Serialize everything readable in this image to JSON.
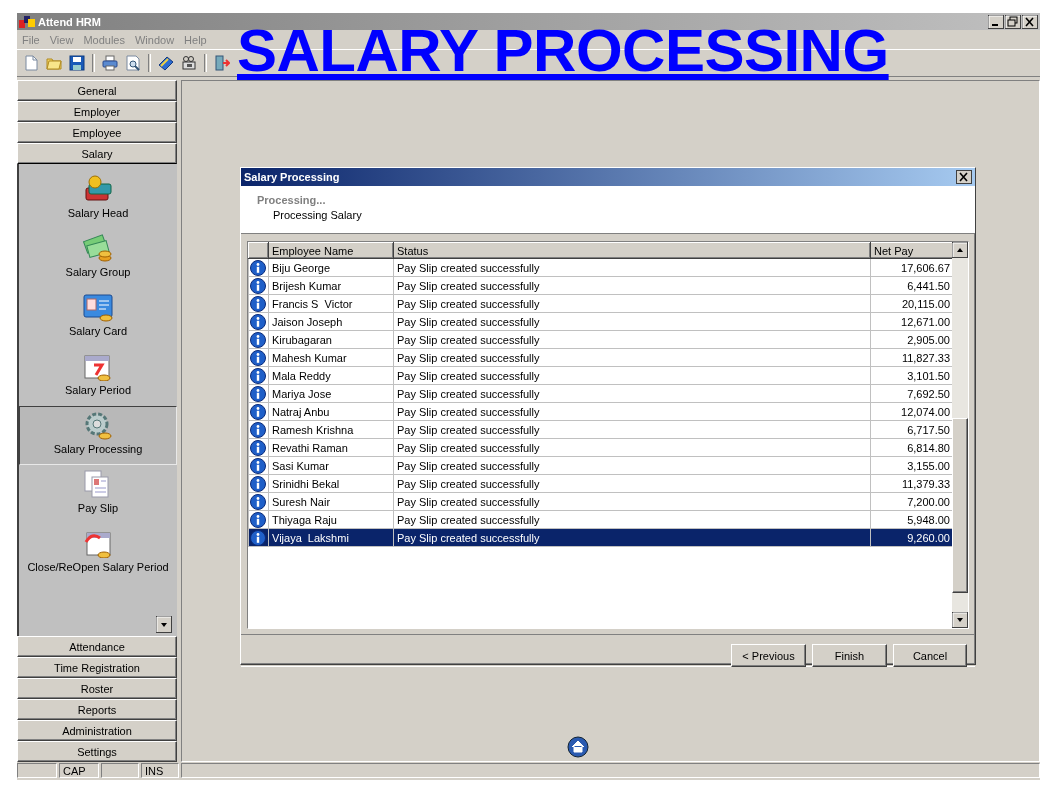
{
  "window": {
    "title": "Attend HRM"
  },
  "menu": [
    "File",
    "View",
    "Modules",
    "Window",
    "Help"
  ],
  "banner": "SALARY PROCESSING",
  "sidebar": {
    "sections": [
      {
        "label": "General",
        "expanded": false
      },
      {
        "label": "Employer",
        "expanded": false
      },
      {
        "label": "Employee",
        "expanded": false
      },
      {
        "label": "Salary",
        "expanded": true,
        "items": [
          {
            "label": "Salary Head",
            "selected": false
          },
          {
            "label": "Salary Group",
            "selected": false
          },
          {
            "label": "Salary Card",
            "selected": false
          },
          {
            "label": "Salary Period",
            "selected": false
          },
          {
            "label": "Salary Processing",
            "selected": true
          },
          {
            "label": "Pay Slip",
            "selected": false
          },
          {
            "label": "Close/ReOpen Salary Period",
            "selected": false
          }
        ]
      },
      {
        "label": "Attendance",
        "expanded": false
      },
      {
        "label": "Time Registration",
        "expanded": false
      },
      {
        "label": "Roster",
        "expanded": false
      },
      {
        "label": "Reports",
        "expanded": false
      },
      {
        "label": "Administration",
        "expanded": false
      },
      {
        "label": "Settings",
        "expanded": false
      }
    ]
  },
  "dialog": {
    "title": "Salary Processing",
    "heading": "Processing...",
    "subheading": "Processing Salary",
    "table": {
      "columns": [
        "Employee Name",
        "Status",
        "Net Pay"
      ],
      "rows": [
        {
          "employee_name": "Biju George",
          "status": "Pay Slip created successfully",
          "net_pay": "17,606.67",
          "selected": false
        },
        {
          "employee_name": "Brijesh Kumar",
          "status": "Pay Slip created successfully",
          "net_pay": "6,441.50",
          "selected": false
        },
        {
          "employee_name": "Francis S  Victor",
          "status": "Pay Slip created successfully",
          "net_pay": "20,115.00",
          "selected": false
        },
        {
          "employee_name": "Jaison Joseph",
          "status": "Pay Slip created successfully",
          "net_pay": "12,671.00",
          "selected": false
        },
        {
          "employee_name": "Kirubagaran",
          "status": "Pay Slip created successfully",
          "net_pay": "2,905.00",
          "selected": false
        },
        {
          "employee_name": "Mahesh Kumar",
          "status": "Pay Slip created successfully",
          "net_pay": "11,827.33",
          "selected": false
        },
        {
          "employee_name": "Mala Reddy",
          "status": "Pay Slip created successfully",
          "net_pay": "3,101.50",
          "selected": false
        },
        {
          "employee_name": "Mariya Jose",
          "status": "Pay Slip created successfully",
          "net_pay": "7,692.50",
          "selected": false
        },
        {
          "employee_name": "Natraj Anbu",
          "status": "Pay Slip created successfully",
          "net_pay": "12,074.00",
          "selected": false
        },
        {
          "employee_name": "Ramesh Krishna",
          "status": "Pay Slip created successfully",
          "net_pay": "6,717.50",
          "selected": false
        },
        {
          "employee_name": "Revathi Raman",
          "status": "Pay Slip created successfully",
          "net_pay": "6,814.80",
          "selected": false
        },
        {
          "employee_name": "Sasi Kumar",
          "status": "Pay Slip created successfully",
          "net_pay": "3,155.00",
          "selected": false
        },
        {
          "employee_name": "Srinidhi Bekal",
          "status": "Pay Slip created successfully",
          "net_pay": "11,379.33",
          "selected": false
        },
        {
          "employee_name": "Suresh Nair",
          "status": "Pay Slip created successfully",
          "net_pay": "7,200.00",
          "selected": false
        },
        {
          "employee_name": "Thiyaga Raju",
          "status": "Pay Slip created successfully",
          "net_pay": "5,948.00",
          "selected": false
        },
        {
          "employee_name": "Vijaya  Lakshmi",
          "status": "Pay Slip created successfully",
          "net_pay": "9,260.00",
          "selected": true
        }
      ]
    },
    "buttons": [
      "< Previous",
      "Finish",
      "Cancel"
    ]
  },
  "status_bar": [
    "CAP",
    "INS"
  ]
}
